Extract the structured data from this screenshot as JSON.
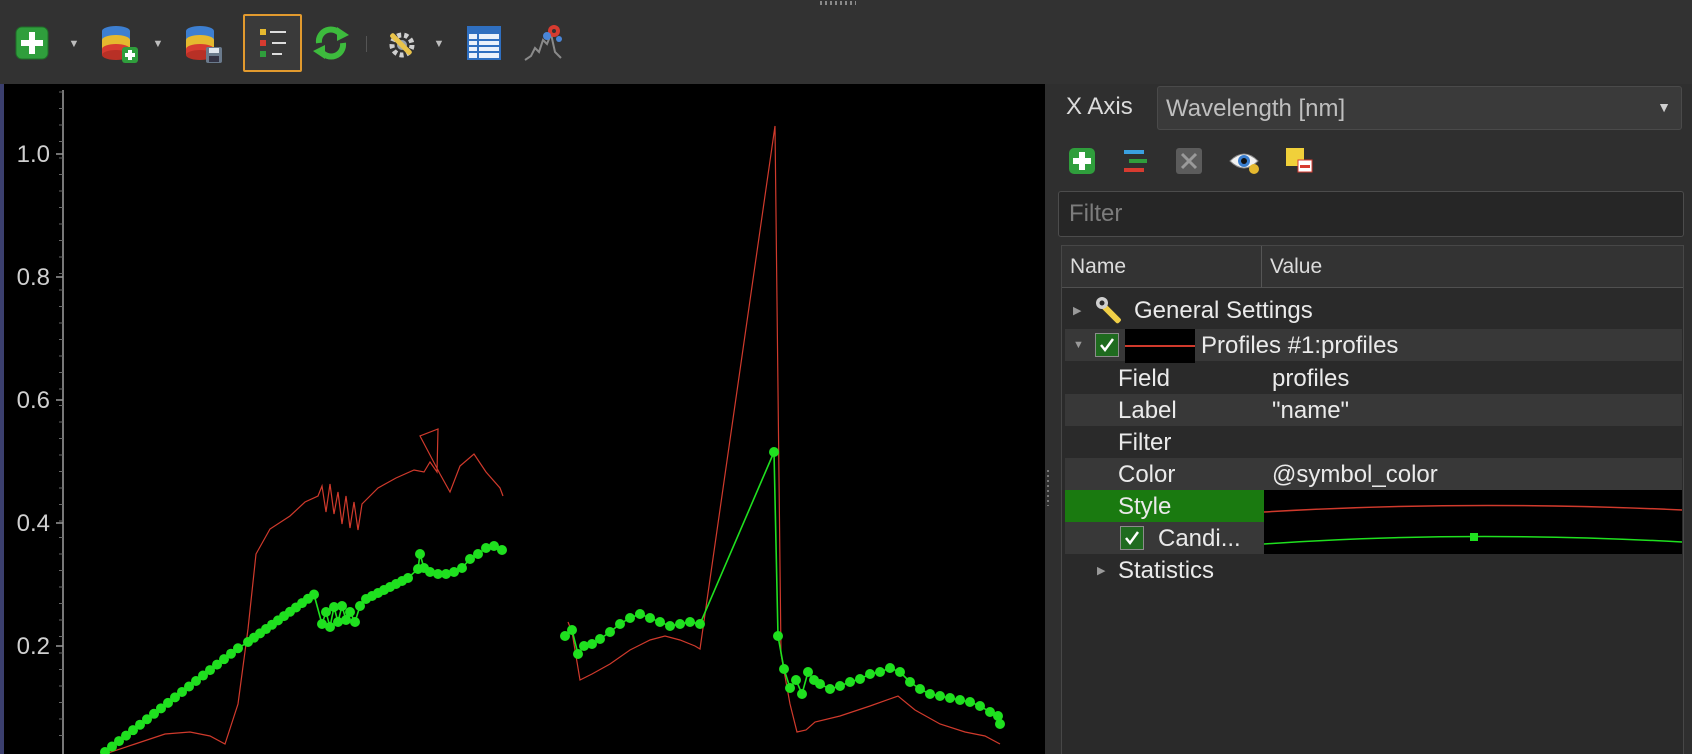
{
  "toolbar": {
    "buttons": [
      {
        "name": "add-profile",
        "icon": "plus-icon",
        "has_dropdown": true
      },
      {
        "name": "add-source",
        "icon": "database-add-icon",
        "has_dropdown": true
      },
      {
        "name": "save-source",
        "icon": "database-save-icon",
        "has_dropdown": false
      },
      {
        "name": "show-legend",
        "icon": "legend-icon",
        "active": true
      },
      {
        "name": "refresh",
        "icon": "refresh-icon"
      },
      {
        "name": "settings",
        "icon": "wrench-gear-icon",
        "has_dropdown": true
      },
      {
        "name": "attribute-table",
        "icon": "table-icon"
      },
      {
        "name": "processing",
        "icon": "spectral-processing-icon"
      }
    ]
  },
  "plot": {
    "background": "#000000",
    "y_ticks": [
      "1.0",
      "0.8",
      "0.6",
      "0.4",
      "0.2"
    ],
    "series": [
      {
        "name": "",
        "color": "#d03a2c",
        "marker": "none"
      },
      {
        "name": "",
        "color": "#1fe01f",
        "marker": "circle"
      }
    ]
  },
  "panel": {
    "x_axis_label": "X Axis",
    "x_axis_value": "Wavelength [nm]",
    "buttons": [
      "add-icon",
      "tree-collapse-icon",
      "remove-icon",
      "visibility-icon",
      "remove-selected-icon"
    ],
    "filter_placeholder": "Filter",
    "tree": {
      "col_name": "Name",
      "col_value": "Value",
      "rows": {
        "general": "General Settings",
        "profiles": "Profiles #1:profiles",
        "field_name": "Field",
        "field_value": "profiles",
        "label_name": "Label",
        "label_value": "\"name\"",
        "filter_name": "Filter",
        "filter_value": "",
        "color_name": "Color",
        "color_value": "@symbol_color",
        "style_name": "Style",
        "candi_name": "Candi...",
        "statistics": "Statistics"
      }
    }
  },
  "colors": {
    "accent_orange": "#e29a2e",
    "selection_green": "#1a7a10",
    "profile_red": "#d03a2c",
    "candidate_green": "#1fe01f"
  }
}
